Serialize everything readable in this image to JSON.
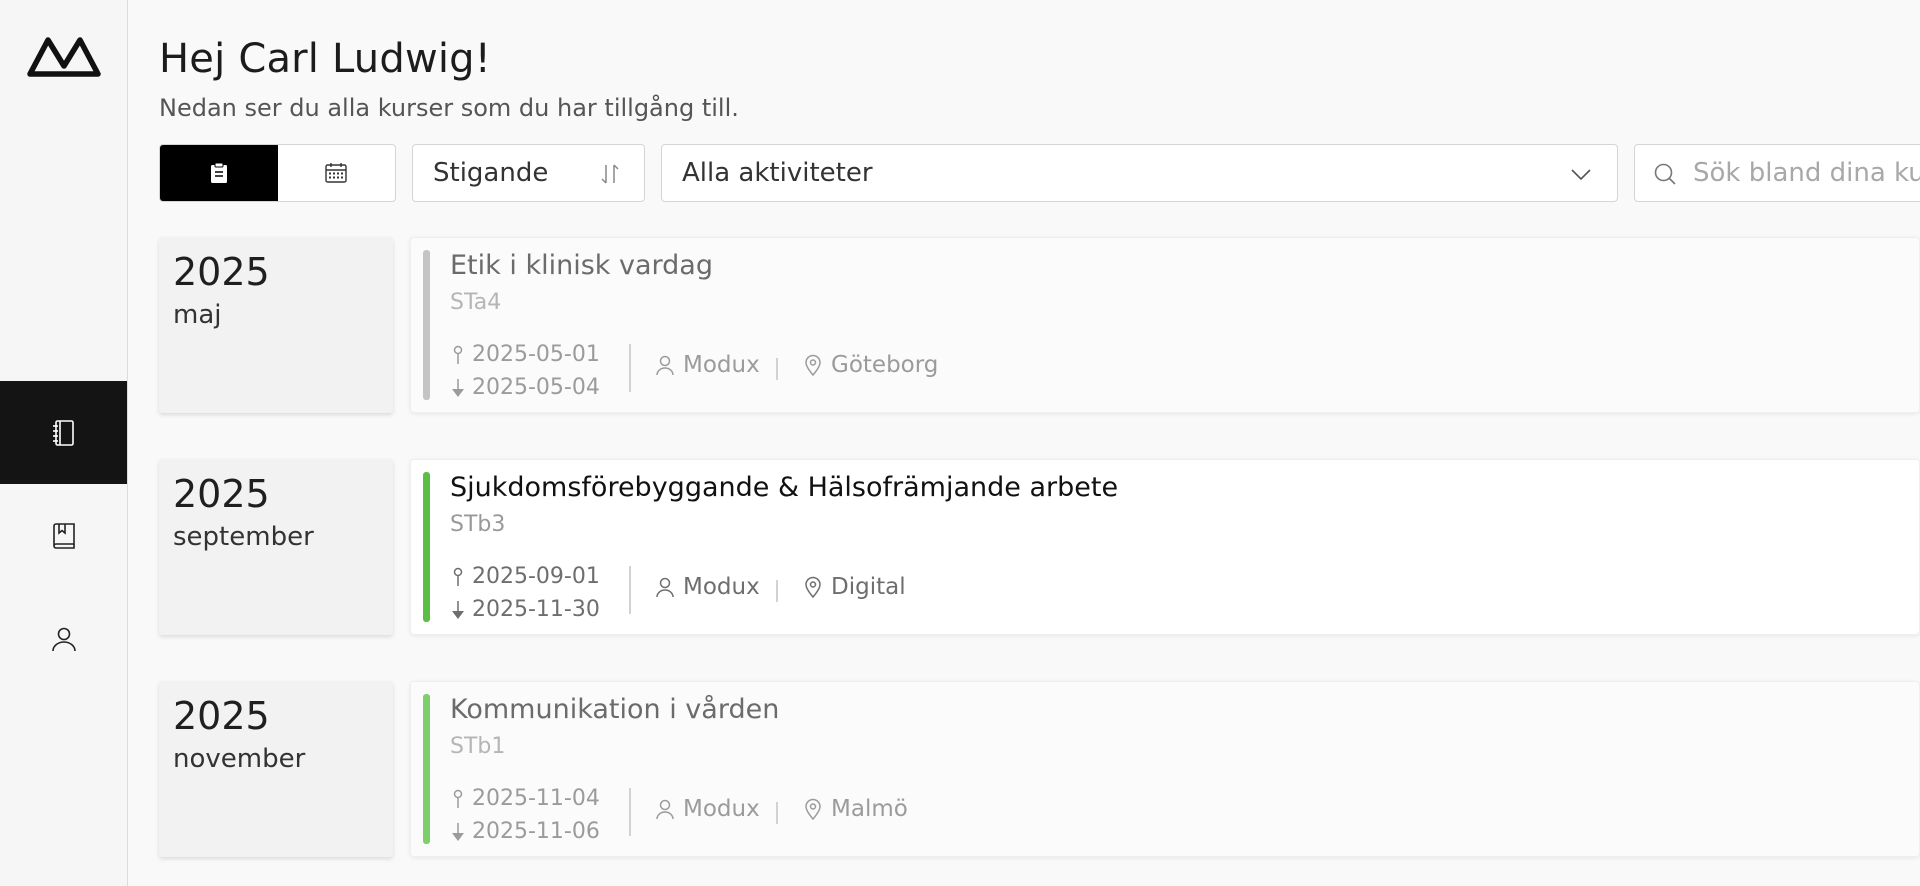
{
  "brand": {
    "logo_icon": "modux-logo-icon"
  },
  "sidebar": {
    "items": [
      {
        "name": "courses",
        "icon": "notebook-icon",
        "active": true
      },
      {
        "name": "library",
        "icon": "bookmark-book-icon",
        "active": false
      },
      {
        "name": "profile",
        "icon": "user-icon",
        "active": false
      }
    ]
  },
  "header": {
    "greeting": "Hej Carl Ludwig!",
    "subtitle": "Nedan ser du alla kurser som du har tillgång till."
  },
  "toolbar": {
    "view_modes": [
      {
        "icon": "clipboard-icon",
        "active": true
      },
      {
        "icon": "calendar-icon",
        "active": false
      }
    ],
    "sort": {
      "value": "Stigande",
      "icon": "sort-icon"
    },
    "activity_filter": {
      "value": "Alla aktiviteter",
      "icon": "chevron-down-icon"
    },
    "search": {
      "placeholder": "Sök bland dina kurser",
      "value": ""
    }
  },
  "courses": [
    {
      "year": "2025",
      "month": "maj",
      "title": "Etik i klinisk vardag",
      "code": "STa4",
      "start": "2025-05-01",
      "end": "2025-05-04",
      "organizer": "Modux",
      "location": "Göteborg",
      "accent_color": "#c4c4c4",
      "faded": true
    },
    {
      "year": "2025",
      "month": "september",
      "title": "Sjukdomsförebyggande & Hälsofrämjande arbete",
      "code": "STb3",
      "start": "2025-09-01",
      "end": "2025-11-30",
      "organizer": "Modux",
      "location": "Digital",
      "accent_color": "#5bbf45",
      "faded": false
    },
    {
      "year": "2025",
      "month": "november",
      "title": "Kommunikation i vården",
      "code": "STb1",
      "start": "2025-11-04",
      "end": "2025-11-06",
      "organizer": "Modux",
      "location": "Malmö",
      "accent_color": "#7ccf6a",
      "faded": true
    }
  ]
}
